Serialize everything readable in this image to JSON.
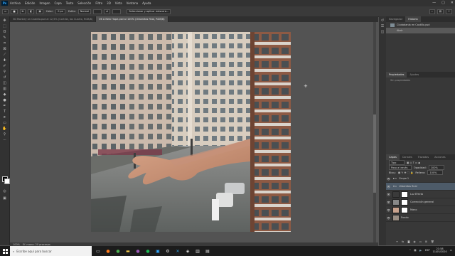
{
  "app": {
    "logo": "Ps"
  },
  "menu": [
    "Archivo",
    "Edición",
    "Imagen",
    "Capa",
    "Texto",
    "Selección",
    "Filtro",
    "3D",
    "Vista",
    "Ventana",
    "Ayuda"
  ],
  "window_controls": {
    "minimize": "—",
    "maximize": "▢",
    "close": "✕"
  },
  "options": {
    "feather_label": "Calar:",
    "feather_value": "0 px",
    "style_label": "Estilo:",
    "style_value": "Normal",
    "select_mask_button": "Seleccionar y aplicar máscara..."
  },
  "tabs": [
    {
      "label": "3D Monkey on Castillo.psd al 12,5% (Cortilla, las Cuarto, RGB/8)",
      "active": false
    },
    {
      "label": "06 A New Hope.psd al 100% (Urbanitos final, RGB/8)",
      "active": true
    }
  ],
  "status": {
    "zoom": "100%",
    "doc": "Ef. mano: 20 procesos"
  },
  "history_panel": {
    "tabs": [
      "Navegador",
      "Historia"
    ],
    "items": [
      {
        "label": "Ciudadanía en Castillo.psd",
        "selected": false
      },
      {
        "label": "Abrir",
        "selected": true
      }
    ]
  },
  "properties_panel": {
    "tabs": [
      "Propiedades",
      "Ajustes"
    ],
    "hint": "Sin propiedades"
  },
  "layers_panel": {
    "tabs": [
      "Capas",
      "Canales",
      "Trazados",
      "Acciones"
    ],
    "filter_label": "Tipo",
    "blend_mode": "Paso a través",
    "opacity_label": "Opacidad:",
    "opacity_value": "100%",
    "fill_label": "Relleno:",
    "fill_value": "100%",
    "lock_label": "Bloq.:",
    "layers": [
      {
        "name": "Grupo 1",
        "type": "group",
        "active": false
      },
      {
        "name": "Urbanitos final",
        "type": "group",
        "active": true
      },
      {
        "name": "Luz Efecto",
        "type": "layer",
        "active": false
      },
      {
        "name": "Corrección general",
        "type": "layer",
        "active": false
      },
      {
        "name": "Mano",
        "type": "layer",
        "active": false
      },
      {
        "name": "Fondo",
        "type": "layer",
        "active": false
      }
    ]
  },
  "taskbar": {
    "search_placeholder": "Escribe aquí para buscar",
    "time": "21:58",
    "date": "11/05/2020",
    "lang": "ESP"
  }
}
